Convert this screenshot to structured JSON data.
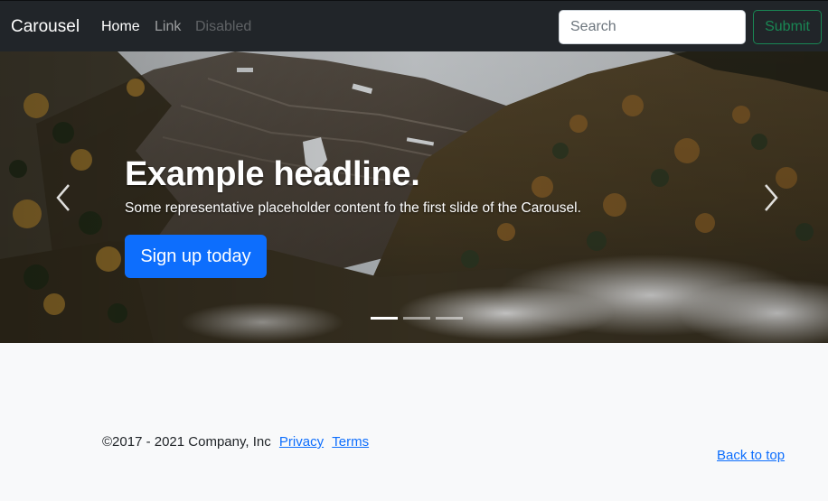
{
  "navbar": {
    "brand": "Carousel",
    "links": [
      {
        "label": "Home",
        "state": "active"
      },
      {
        "label": "Link",
        "state": "normal"
      },
      {
        "label": "Disabled",
        "state": "disabled"
      }
    ],
    "search": {
      "placeholder": "Search",
      "value": ""
    },
    "submit_label": "Submit"
  },
  "carousel": {
    "headline": "Example headline.",
    "text": "Some representative placeholder content fo the first slide of the Carousel.",
    "button_label": "Sign up today",
    "indicators": [
      {
        "active": true
      },
      {
        "active": false
      },
      {
        "active": false
      }
    ],
    "prev_icon": "chevron-left-icon",
    "next_icon": "chevron-right-icon"
  },
  "footer": {
    "copyright": "©2017 - 2021 Company, Inc",
    "privacy": "Privacy",
    "terms": "Terms",
    "back_to_top": "Back to top"
  },
  "colors": {
    "navbar_bg": "#212529",
    "primary": "#0d6efd",
    "success": "#198754",
    "page_bg": "#f8f9fa"
  }
}
